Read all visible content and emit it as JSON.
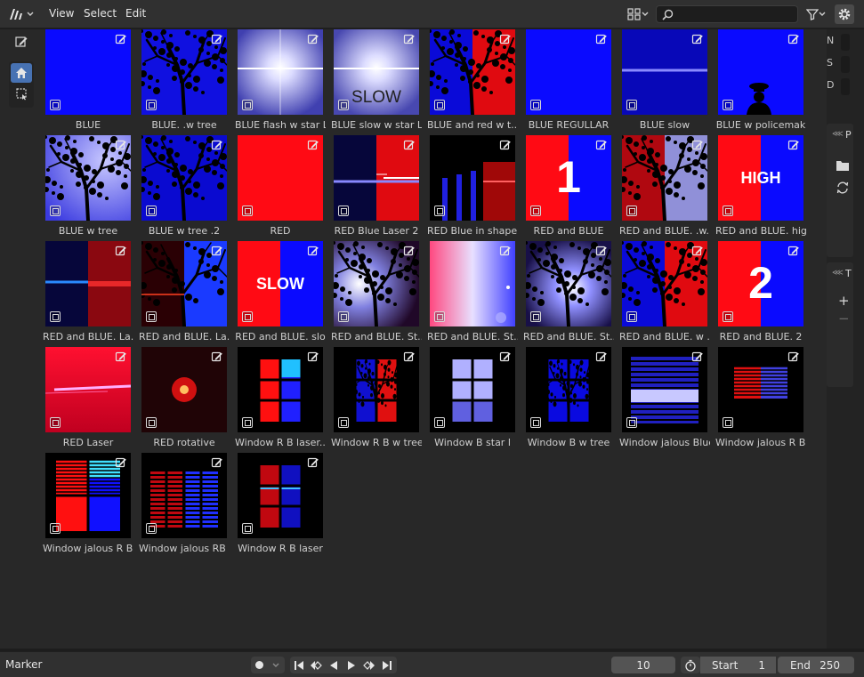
{
  "header": {
    "menus": [
      "View",
      "Select",
      "Edit"
    ],
    "search": {
      "value": "",
      "placeholder": ""
    }
  },
  "assets": [
    {
      "label": "BLUE",
      "thumb": "blue"
    },
    {
      "label": "BLUE. .w tree",
      "thumb": "blue-tree"
    },
    {
      "label": "BLUE flash w star L",
      "thumb": "flash"
    },
    {
      "label": "BLUE slow w star L",
      "thumb": "flash-slow",
      "overlay": "SLOW"
    },
    {
      "label": "BLUE and red w t...",
      "thumb": "blue-red-tree"
    },
    {
      "label": "BLUE REGULLAR",
      "thumb": "blue"
    },
    {
      "label": "BLUE slow",
      "thumb": "blue-slow"
    },
    {
      "label": "BLUE w policemak",
      "thumb": "blue-police"
    },
    {
      "label": "BLUE w tree",
      "thumb": "lightblue-tree"
    },
    {
      "label": "BLUE w tree .2",
      "thumb": "blue-tree2"
    },
    {
      "label": "RED",
      "thumb": "red"
    },
    {
      "label": "RED Blue Laser 2",
      "thumb": "laser2"
    },
    {
      "label": "RED Blue in shape...",
      "thumb": "shape"
    },
    {
      "label": "RED and BLUE",
      "thumb": "redblue",
      "overlay": "1"
    },
    {
      "label": "RED and BLUE. .w...",
      "thumb": "redblue-tree"
    },
    {
      "label": "RED and BLUE. high",
      "thumb": "redblue",
      "overlay": "HIGH"
    },
    {
      "label": "RED and BLUE. La...",
      "thumb": "laser-a"
    },
    {
      "label": "RED and BLUE. La...",
      "thumb": "laser-b"
    },
    {
      "label": "RED and BLUE. slo",
      "thumb": "redblue",
      "overlay": "SLOW"
    },
    {
      "label": "RED and BLUE. St...",
      "thumb": "star-tree"
    },
    {
      "label": "RED and BLUE. St...",
      "thumb": "star-pink"
    },
    {
      "label": "RED and BLUE. St...",
      "thumb": "star-tree2"
    },
    {
      "label": "RED and BLUE. w ...",
      "thumb": "blue-red-tree"
    },
    {
      "label": "RED and BLUE. 2",
      "thumb": "redblue",
      "overlay": "2"
    },
    {
      "label": "RED Laser",
      "thumb": "red-laser"
    },
    {
      "label": "RED rotative",
      "thumb": "rotative"
    },
    {
      "label": "Window R B laser...",
      "thumb": "win-laser"
    },
    {
      "label": "Window R B w tree",
      "thumb": "win-rb-tree"
    },
    {
      "label": "Window B star l",
      "thumb": "win-star"
    },
    {
      "label": "Window B w tree",
      "thumb": "win-b-tree"
    },
    {
      "label": "Window jalous Blue",
      "thumb": "jalous-blue"
    },
    {
      "label": "Window jalous R B...",
      "thumb": "jalous-rb"
    },
    {
      "label": "Window jalous R B...",
      "thumb": "jalous-rb2"
    },
    {
      "label": "Window jalous RB ...",
      "thumb": "jalous-rb3"
    },
    {
      "label": "Window R B laser",
      "thumb": "win-laser2"
    }
  ],
  "sidebar": {
    "tabs": [
      "N",
      "S",
      "D"
    ],
    "panel1": "P",
    "panel2": "T"
  },
  "footer": {
    "marker": "Marker",
    "current_frame": "10",
    "start_label": "Start",
    "start_value": "1",
    "end_label": "End",
    "end_value": "250"
  },
  "colors": {
    "header": "#303030",
    "editor": "#282828",
    "field": "#545454",
    "blue": "#0a0aff",
    "red": "#ff0a14"
  }
}
